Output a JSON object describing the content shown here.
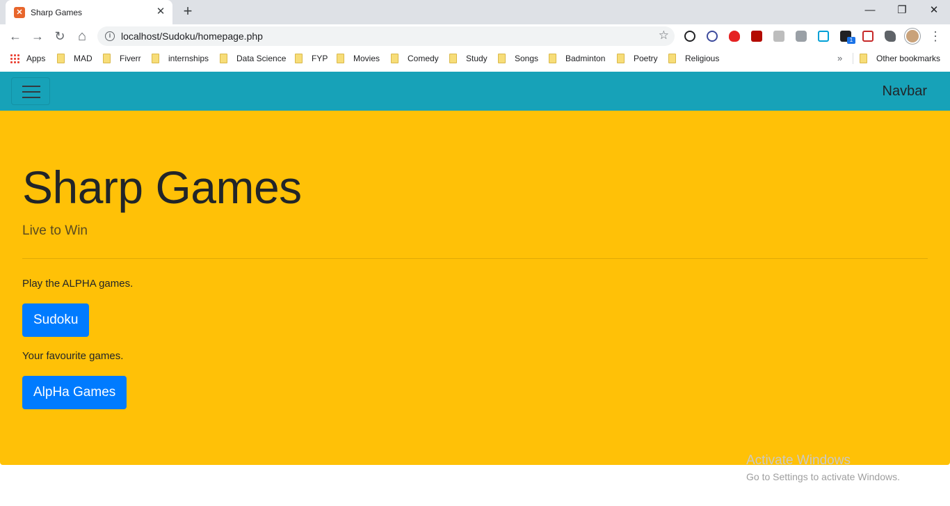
{
  "browser": {
    "tab_title": "Sharp Games",
    "tab_close": "✕",
    "new_tab": "+",
    "window_controls": {
      "minimize": "—",
      "restore": "❐",
      "close": "✕"
    },
    "nav": {
      "back": "←",
      "forward": "→",
      "reload": "↻",
      "home": "⌂"
    },
    "url": "localhost/Sudoku/homepage.php",
    "extension_badge": "1",
    "bookmarks": [
      {
        "label": "Apps"
      },
      {
        "label": "MAD"
      },
      {
        "label": "Fiverr"
      },
      {
        "label": "internships"
      },
      {
        "label": "Data Science"
      },
      {
        "label": "FYP"
      },
      {
        "label": "Movies"
      },
      {
        "label": "Comedy"
      },
      {
        "label": "Study"
      },
      {
        "label": "Songs"
      },
      {
        "label": "Badminton"
      },
      {
        "label": "Poetry"
      },
      {
        "label": "Religious"
      }
    ],
    "bookmarks_overflow": "»",
    "other_bookmarks": "Other bookmarks"
  },
  "navbar": {
    "brand": "Navbar"
  },
  "jumbotron": {
    "title": "Sharp Games",
    "lead": "Live to Win",
    "sections": [
      {
        "text": "Play the ALPHA games.",
        "button": "Sudoku"
      },
      {
        "text": "Your favourite games.",
        "button": "AlpHa Games"
      }
    ]
  },
  "watermark": {
    "title": "Activate Windows",
    "subtitle": "Go to Settings to activate Windows."
  },
  "colors": {
    "navbar": "#17a2b8",
    "jumbotron": "#ffc107",
    "primary_button": "#007bff"
  }
}
